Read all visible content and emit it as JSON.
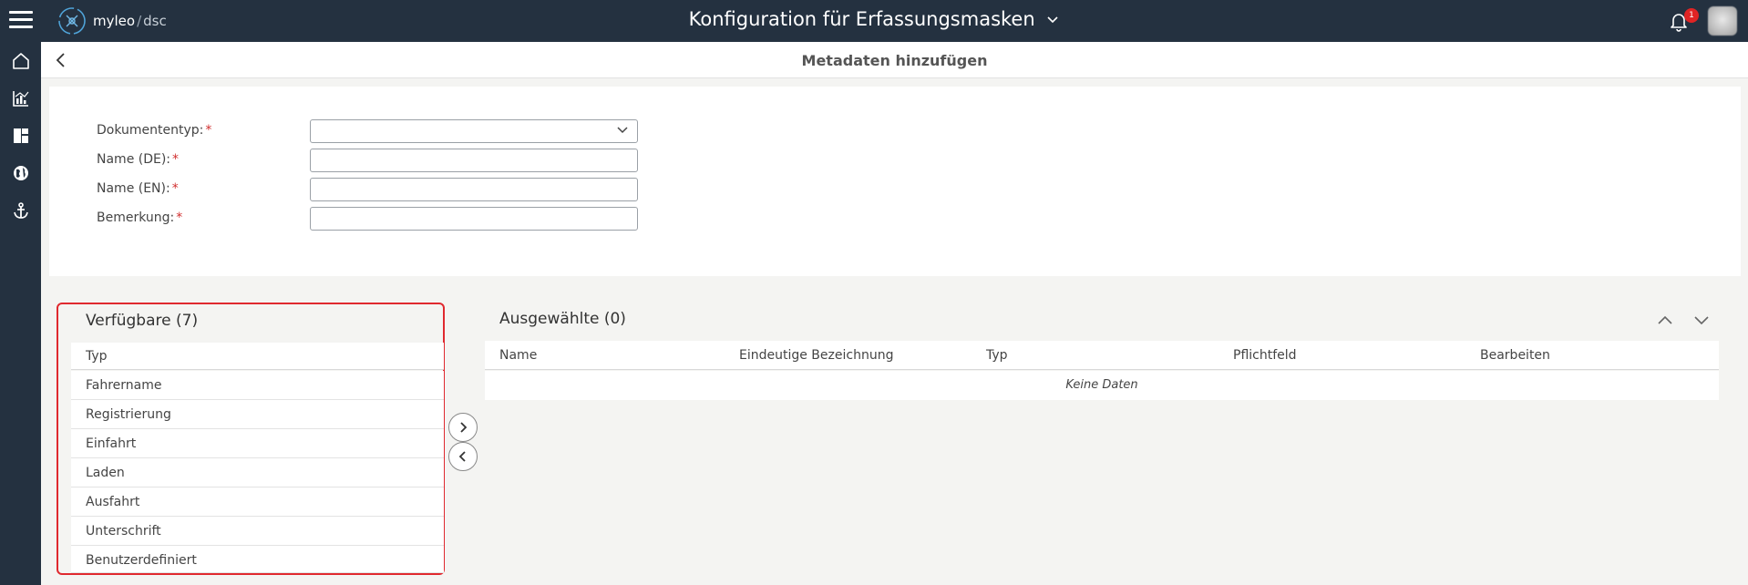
{
  "header": {
    "brand": "myleo",
    "brand_sep": "/",
    "brand_product": "dsc",
    "title": "Konfiguration für Erfassungsmasken",
    "notification_count": "1",
    "colors": {
      "bar": "#243140",
      "badge": "#e02424",
      "accent": "#e0292f"
    }
  },
  "rail": {
    "icons": [
      "home-icon",
      "chart-icon",
      "dashboard-icon",
      "globe-icon",
      "anchor-icon"
    ]
  },
  "subheader": {
    "title": "Metadaten hinzufügen"
  },
  "form": {
    "doc_type_label": "Dokumententyp:",
    "name_de_label": "Name (DE):",
    "name_en_label": "Name (EN):",
    "remark_label": "Bemerkung:",
    "required_mark": "*",
    "doc_type_value": "",
    "name_de_value": "",
    "name_en_value": "",
    "remark_value": ""
  },
  "available": {
    "title": "Verfügbare (7)",
    "column": "Typ",
    "items": [
      "Fahrername",
      "Registrierung",
      "Einfahrt",
      "Laden",
      "Ausfahrt",
      "Unterschrift",
      "Benutzerdefiniert"
    ]
  },
  "selected": {
    "title": "Ausgewählte (0)",
    "columns": [
      "Name",
      "Eindeutige Bezeichnung",
      "Typ",
      "Pflichtfeld",
      "Bearbeiten"
    ],
    "empty_text": "Keine Daten"
  }
}
